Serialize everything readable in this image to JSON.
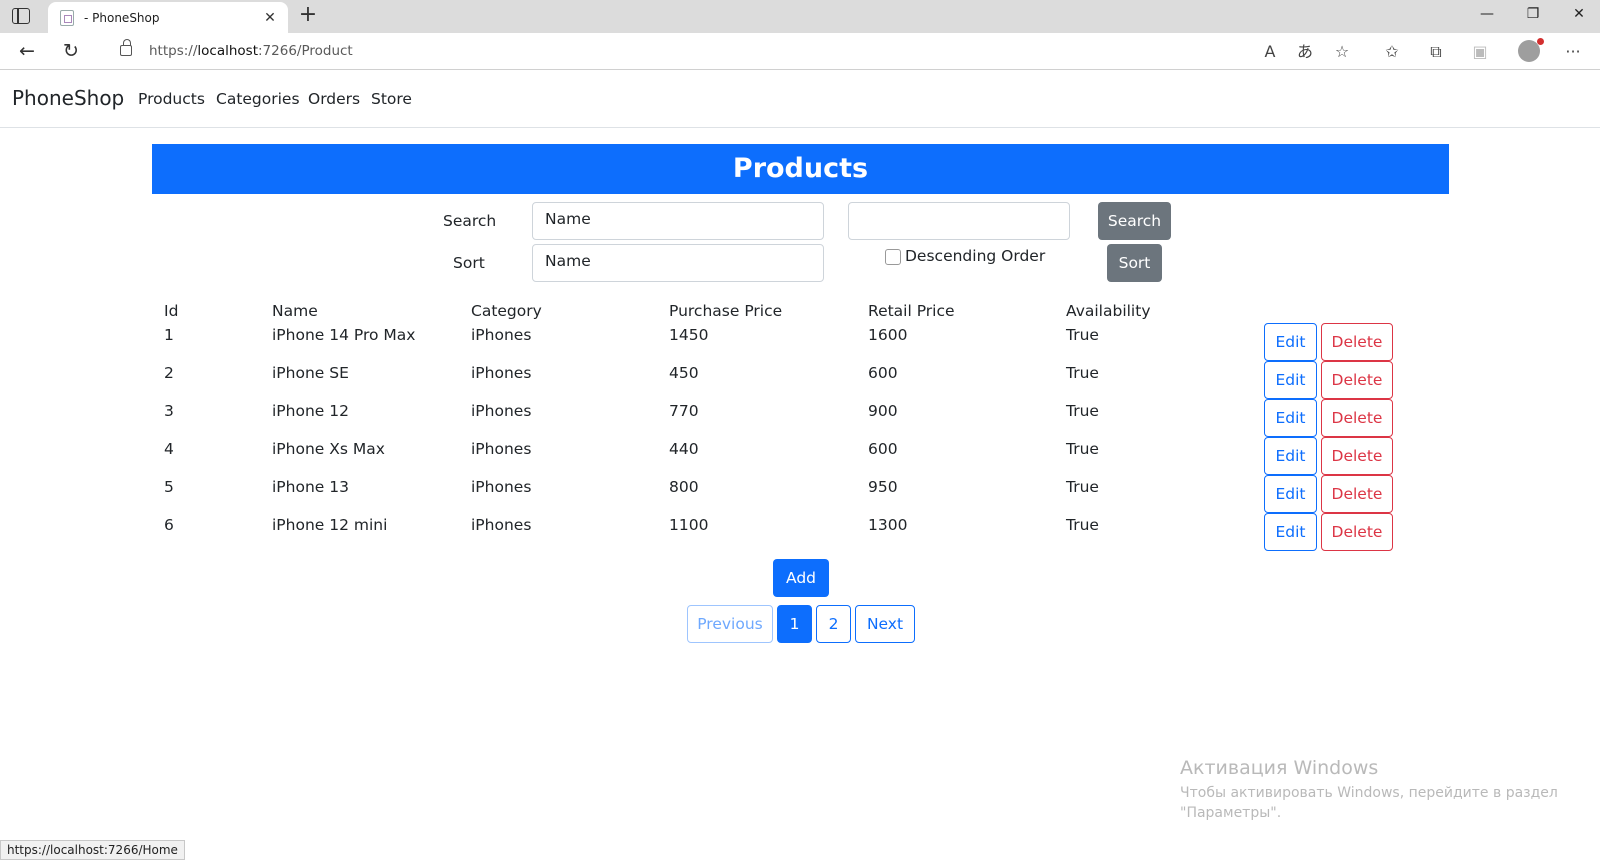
{
  "browser": {
    "tab_title": "- PhoneShop",
    "url_prefix": "https://",
    "url_host": "localhost",
    "url_path": ":7266/Product",
    "status_url": "https://localhost:7266/Home"
  },
  "nav": {
    "brand": "PhoneShop",
    "links": [
      "Products",
      "Categories",
      "Orders",
      "Store"
    ]
  },
  "page": {
    "title": "Products"
  },
  "filters": {
    "search_label": "Search",
    "search_field_value": "Name",
    "search_text_value": "",
    "search_button": "Search",
    "sort_label": "Sort",
    "sort_field_value": "Name",
    "descending_label": "Descending Order",
    "descending_checked": false,
    "sort_button": "Sort"
  },
  "table": {
    "headers": [
      "Id",
      "Name",
      "Category",
      "Purchase Price",
      "Retail Price",
      "Availability"
    ],
    "rows": [
      [
        "1",
        "iPhone 14 Pro Max",
        "iPhones",
        "1450",
        "1600",
        "True"
      ],
      [
        "2",
        "iPhone SE",
        "iPhones",
        "450",
        "600",
        "True"
      ],
      [
        "3",
        "iPhone 12",
        "iPhones",
        "770",
        "900",
        "True"
      ],
      [
        "4",
        "iPhone Xs Max",
        "iPhones",
        "440",
        "600",
        "True"
      ],
      [
        "5",
        "iPhone 13",
        "iPhones",
        "800",
        "950",
        "True"
      ],
      [
        "6",
        "iPhone 12 mini",
        "iPhones",
        "1100",
        "1300",
        "True"
      ]
    ],
    "edit_label": "Edit",
    "delete_label": "Delete"
  },
  "actions": {
    "add_label": "Add"
  },
  "pagination": {
    "previous": "Previous",
    "pages": [
      "1",
      "2"
    ],
    "current_page": "1",
    "next": "Next"
  },
  "watermark": {
    "title": "Активация Windows",
    "text": "Чтобы активировать Windows, перейдите в раздел \"Параметры\"."
  },
  "colors": {
    "primary": "#0d6efd",
    "secondary": "#6c757d",
    "danger": "#dc3545"
  }
}
